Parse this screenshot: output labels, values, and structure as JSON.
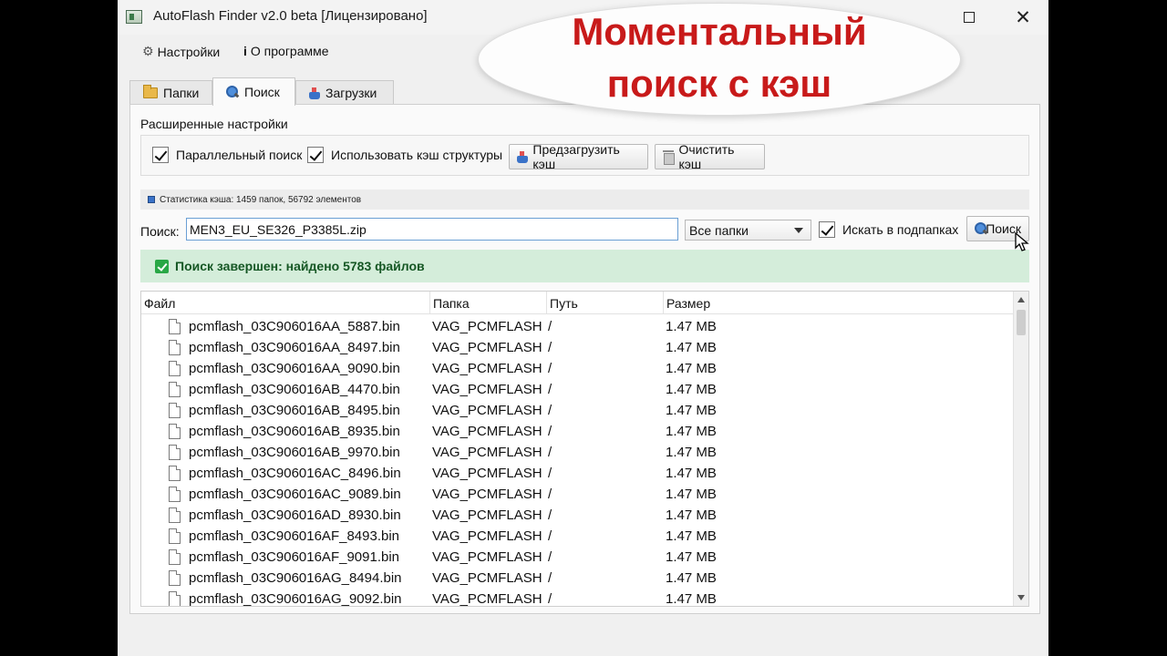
{
  "window": {
    "title": "AutoFlash Finder v2.0 beta [Лицензировано]",
    "maximize_icon": "maximize-icon",
    "close_icon": "close-icon"
  },
  "menu": {
    "settings_label": "Настройки",
    "about_label": "О программе"
  },
  "tabs": [
    {
      "label": "Папки",
      "icon": "folder-icon",
      "active": false
    },
    {
      "label": "Поиск",
      "icon": "search-icon",
      "active": true
    },
    {
      "label": "Загрузки",
      "icon": "download-icon",
      "active": false
    }
  ],
  "advanced": {
    "title": "Расширенные настройки",
    "parallel_search": {
      "label": "Параллельный поиск",
      "checked": true
    },
    "use_cache": {
      "label": "Использовать кэш структуры",
      "checked": true
    },
    "preload_label": "Предзагрузить кэш",
    "clear_label": "Очистить кэш"
  },
  "cache_stats": "Статистика кэша: 1459 папок, 56792 элементов",
  "search": {
    "label": "Поиск:",
    "value": "MEN3_EU_SE326_P3385L.zip",
    "scope": "Все папки",
    "subfolders": {
      "label": "Искать в подпапках",
      "checked": true
    },
    "button_label": "Поиск"
  },
  "status": {
    "text": "Поиск завершен: найдено 5783 файлов",
    "color": "#d4edda"
  },
  "table": {
    "columns": [
      "Файл",
      "Папка",
      "Путь",
      "Размер"
    ],
    "rows": [
      [
        "pcmflash_03C906016AA_5887.bin",
        "VAG_PCMFLASH",
        "/",
        "1.47 MB"
      ],
      [
        "pcmflash_03C906016AA_8497.bin",
        "VAG_PCMFLASH",
        "/",
        "1.47 MB"
      ],
      [
        "pcmflash_03C906016AA_9090.bin",
        "VAG_PCMFLASH",
        "/",
        "1.47 MB"
      ],
      [
        "pcmflash_03C906016AB_4470.bin",
        "VAG_PCMFLASH",
        "/",
        "1.47 MB"
      ],
      [
        "pcmflash_03C906016AB_8495.bin",
        "VAG_PCMFLASH",
        "/",
        "1.47 MB"
      ],
      [
        "pcmflash_03C906016AB_8935.bin",
        "VAG_PCMFLASH",
        "/",
        "1.47 MB"
      ],
      [
        "pcmflash_03C906016AB_9970.bin",
        "VAG_PCMFLASH",
        "/",
        "1.47 MB"
      ],
      [
        "pcmflash_03C906016AC_8496.bin",
        "VAG_PCMFLASH",
        "/",
        "1.47 MB"
      ],
      [
        "pcmflash_03C906016AC_9089.bin",
        "VAG_PCMFLASH",
        "/",
        "1.47 MB"
      ],
      [
        "pcmflash_03C906016AD_8930.bin",
        "VAG_PCMFLASH",
        "/",
        "1.47 MB"
      ],
      [
        "pcmflash_03C906016AF_8493.bin",
        "VAG_PCMFLASH",
        "/",
        "1.47 MB"
      ],
      [
        "pcmflash_03C906016AF_9091.bin",
        "VAG_PCMFLASH",
        "/",
        "1.47 MB"
      ],
      [
        "pcmflash_03C906016AG_8494.bin",
        "VAG_PCMFLASH",
        "/",
        "1.47 MB"
      ],
      [
        "pcmflash_03C906016AG_9092.bin",
        "VAG_PCMFLASH",
        "/",
        "1.47 MB"
      ]
    ]
  },
  "overlay": {
    "line1": "Моментальный",
    "line2": "поиск с кэш",
    "color": "#c81a1a"
  }
}
